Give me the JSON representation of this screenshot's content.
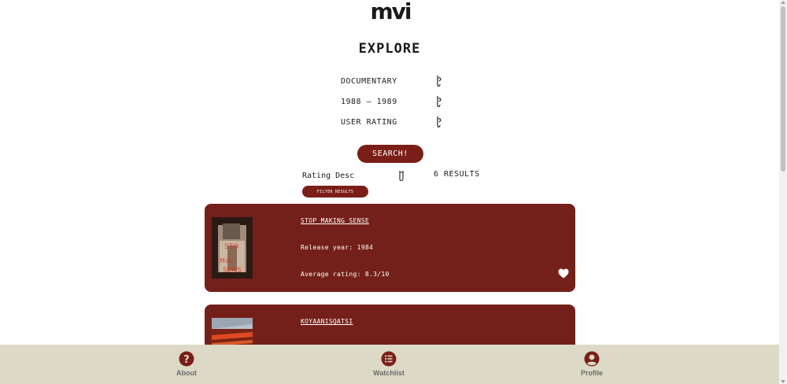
{
  "brand": {
    "logo_text": "mvi"
  },
  "page": {
    "title": "EXPLORE"
  },
  "filters": [
    {
      "label": "DOCUMENTARY",
      "icon": "chevron-down-icon"
    },
    {
      "label": "1988 – 1989",
      "icon": "chevron-down-icon"
    },
    {
      "label": "USER RATING",
      "icon": "chevron-down-icon"
    }
  ],
  "search": {
    "button_label": "SEARCH!"
  },
  "results": {
    "sort_label": "Rating Desc",
    "count_label": "6 RESULTS",
    "filter_button_label": "FILTER RESULTS"
  },
  "movies": [
    {
      "title": "STOP MAKING SENSE",
      "year_label": "Release year: 1984",
      "rating_label": "Average rating: 8.3/10",
      "favorite_icon": "heart-icon"
    },
    {
      "title": "KOYAANISQATSI"
    }
  ],
  "bottom_nav": [
    {
      "label": "About",
      "icon": "question-circle-icon"
    },
    {
      "label": "Watchlist",
      "icon": "list-circle-icon"
    },
    {
      "label": "Profile",
      "icon": "user-circle-icon"
    }
  ],
  "colors": {
    "accent": "#7a1f18",
    "card": "#74201a",
    "nav_bg": "#dcd9c6",
    "nav_text": "#6b6b6b"
  }
}
